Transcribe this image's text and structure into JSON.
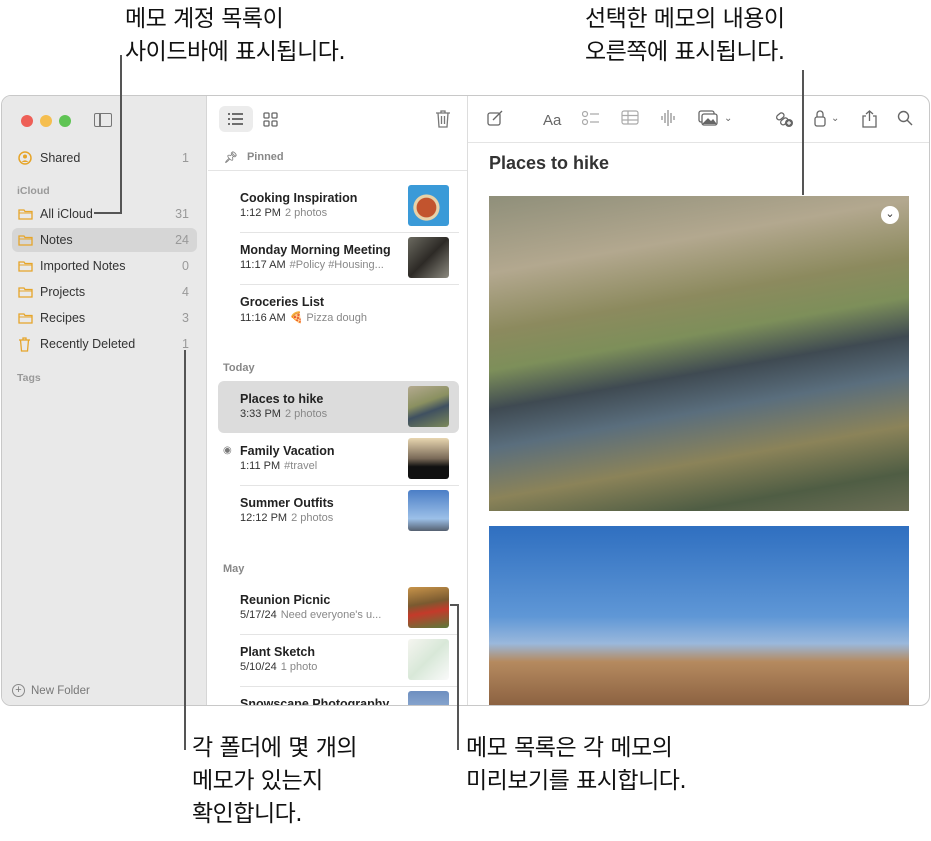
{
  "callouts": {
    "top_left": [
      "메모 계정 목록이",
      "사이드바에 표시됩니다."
    ],
    "top_right": [
      "선택한 메모의 내용이",
      "오른쪽에 표시됩니다."
    ],
    "bottom_left": [
      "각 폴더에 몇 개의",
      "메모가 있는지",
      "확인합니다."
    ],
    "bottom_right": [
      "메모 목록은 각 메모의",
      "미리보기를 표시합니다."
    ]
  },
  "sidebar": {
    "shared": {
      "label": "Shared",
      "count": "1"
    },
    "icloud_header": "iCloud",
    "folders": [
      {
        "label": "All iCloud",
        "count": "31"
      },
      {
        "label": "Notes",
        "count": "24"
      },
      {
        "label": "Imported Notes",
        "count": "0"
      },
      {
        "label": "Projects",
        "count": "4"
      },
      {
        "label": "Recipes",
        "count": "3"
      },
      {
        "label": "Recently Deleted",
        "count": "1"
      }
    ],
    "tags_header": "Tags",
    "new_folder": "New Folder"
  },
  "list": {
    "pinned_header": "Pinned",
    "today_header": "Today",
    "may_header": "May",
    "notes": [
      {
        "title": "Cooking Inspiration",
        "time": "1:12 PM",
        "preview": "2 photos"
      },
      {
        "title": "Monday Morning Meeting",
        "time": "11:17 AM",
        "preview": "#Policy #Housing..."
      },
      {
        "title": "Groceries List",
        "time": "11:16 AM",
        "preview": "🍕 Pizza dough"
      },
      {
        "title": "Places to hike",
        "time": "3:33 PM",
        "preview": "2 photos"
      },
      {
        "title": "Family Vacation",
        "time": "1:11 PM",
        "preview": "#travel"
      },
      {
        "title": "Summer Outfits",
        "time": "12:12 PM",
        "preview": "2 photos"
      },
      {
        "title": "Reunion Picnic",
        "time": "5/17/24",
        "preview": "Need everyone's u..."
      },
      {
        "title": "Plant Sketch",
        "time": "5/10/24",
        "preview": "1 photo"
      },
      {
        "title": "Snowscape Photography",
        "time": "",
        "preview": ""
      }
    ]
  },
  "editor": {
    "title": "Places to hike",
    "format_label": "Aa"
  }
}
